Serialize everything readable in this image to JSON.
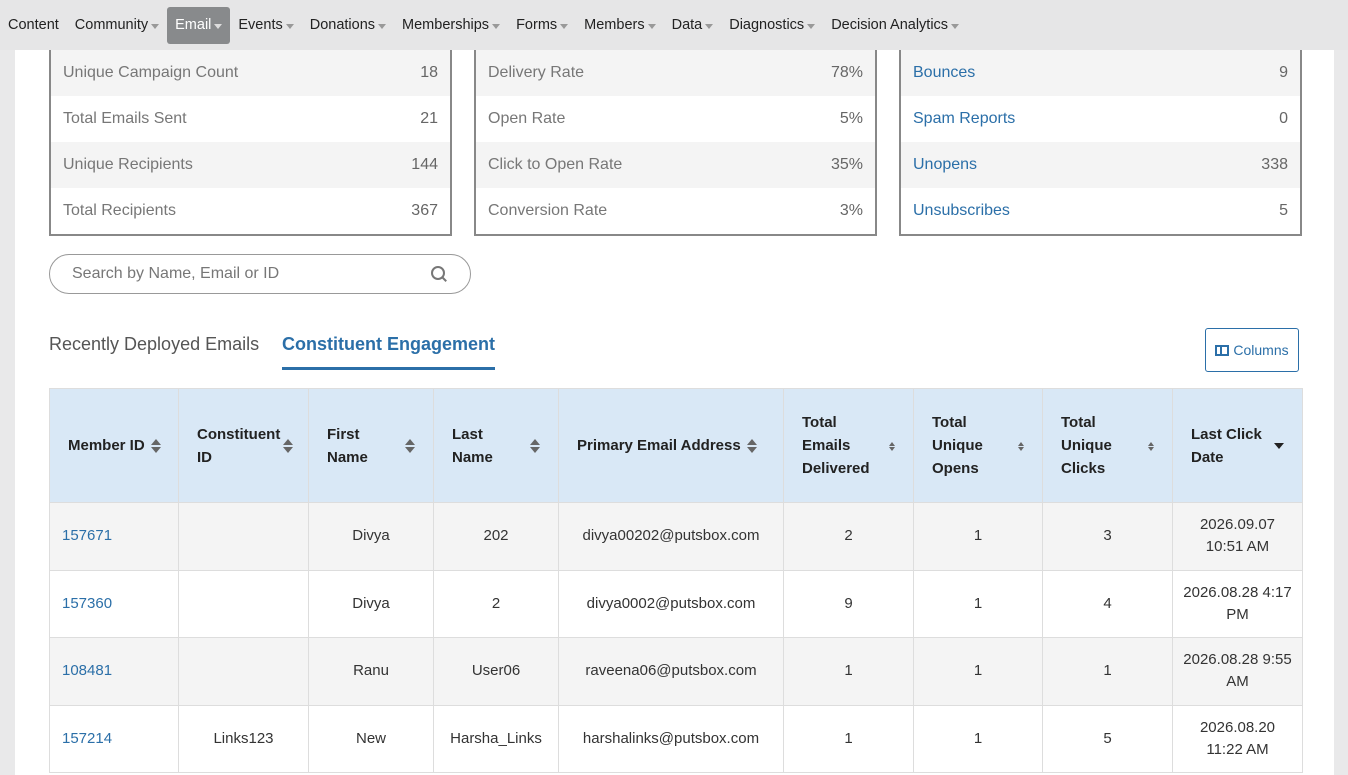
{
  "nav": {
    "items": [
      {
        "label": "Content",
        "caret": false,
        "active": false
      },
      {
        "label": "Community",
        "caret": true,
        "active": false
      },
      {
        "label": "Email",
        "caret": true,
        "active": true
      },
      {
        "label": "Events",
        "caret": true,
        "active": false
      },
      {
        "label": "Donations",
        "caret": true,
        "active": false
      },
      {
        "label": "Memberships",
        "caret": true,
        "active": false
      },
      {
        "label": "Forms",
        "caret": true,
        "active": false
      },
      {
        "label": "Members",
        "caret": true,
        "active": false
      },
      {
        "label": "Data",
        "caret": true,
        "active": false
      },
      {
        "label": "Diagnostics",
        "caret": true,
        "active": false
      },
      {
        "label": "Decision Analytics",
        "caret": true,
        "active": false
      }
    ]
  },
  "cards": {
    "summary": [
      {
        "label": "Unique Campaign Count",
        "value": "18"
      },
      {
        "label": "Total Emails Sent",
        "value": "21"
      },
      {
        "label": "Unique Recipients",
        "value": "144"
      },
      {
        "label": "Total Recipients",
        "value": "367"
      }
    ],
    "rates": [
      {
        "label": "Delivery Rate",
        "value": "78%"
      },
      {
        "label": "Open Rate",
        "value": "5%"
      },
      {
        "label": "Click to Open Rate",
        "value": "35%"
      },
      {
        "label": "Conversion Rate",
        "value": "3%"
      }
    ],
    "issues": [
      {
        "label": "Bounces",
        "value": "9"
      },
      {
        "label": "Spam Reports",
        "value": "0"
      },
      {
        "label": "Unopens",
        "value": "338"
      },
      {
        "label": "Unsubscribes",
        "value": "5"
      }
    ]
  },
  "search": {
    "placeholder": "Search by Name, Email or ID",
    "value": ""
  },
  "tabs": {
    "recent": "Recently Deployed Emails",
    "engagement": "Constituent Engagement"
  },
  "columns_button": "Columns",
  "table": {
    "headers": [
      "Member ID",
      "Constituent ID",
      "First Name",
      "Last Name",
      "Primary Email Address",
      "Total Emails Delivered",
      "Total Unique Opens",
      "Total Unique Clicks",
      "Last Click Date"
    ],
    "rows": [
      [
        "157671",
        "",
        "Divya",
        "202",
        "divya00202@putsbox.com",
        "2",
        "1",
        "3",
        "2026.09.07 10:51 AM"
      ],
      [
        "157360",
        "",
        "Divya",
        "2",
        "divya0002@putsbox.com",
        "9",
        "1",
        "4",
        "2026.08.28 4:17 PM"
      ],
      [
        "108481",
        "",
        "Ranu",
        "User06",
        "raveena06@putsbox.com",
        "1",
        "1",
        "1",
        "2026.08.28 9:55 AM"
      ],
      [
        "157214",
        "Links123",
        "New",
        "Harsha_Links",
        "harshalinks@putsbox.com",
        "1",
        "1",
        "5",
        "2026.08.20 11:22 AM"
      ]
    ]
  }
}
